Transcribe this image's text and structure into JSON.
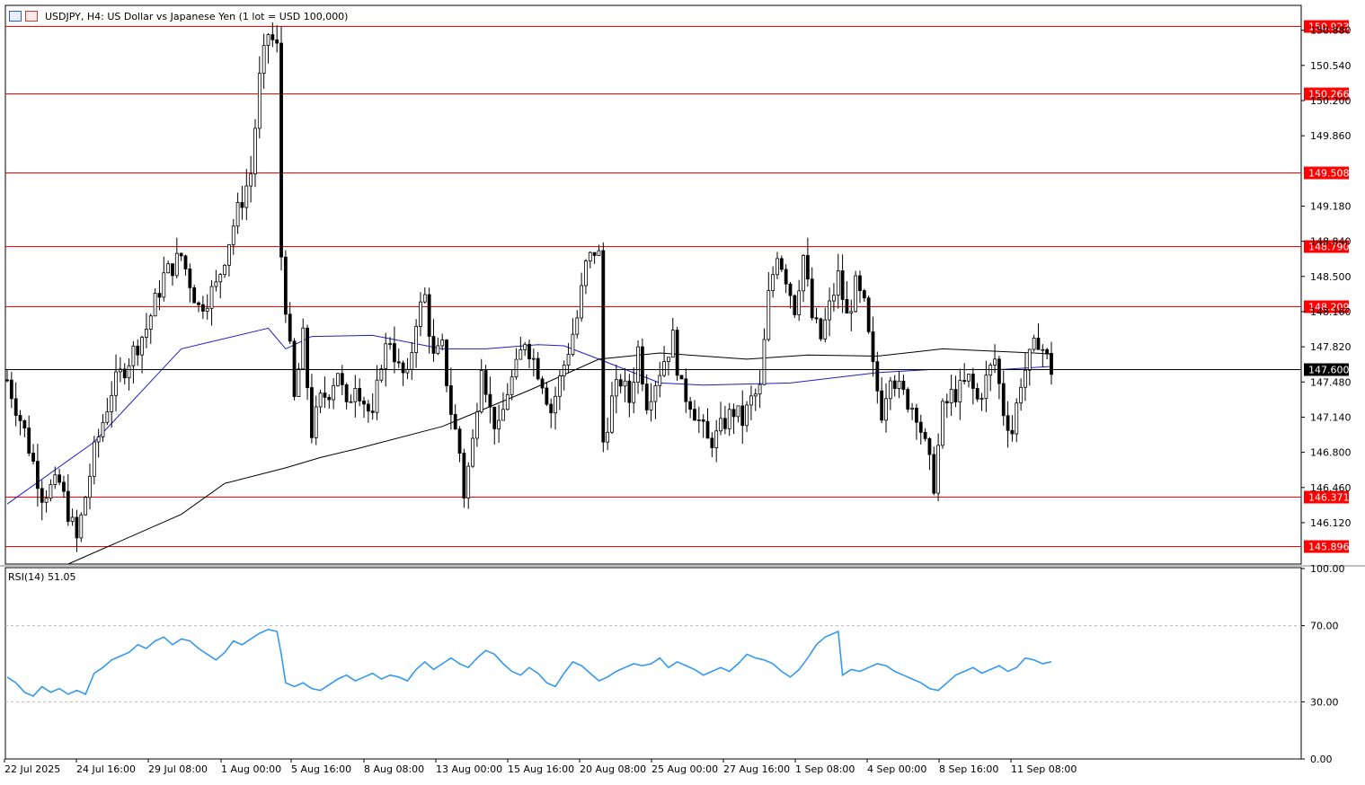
{
  "header": {
    "title": "USDJPY, H4:  US Dollar vs Japanese Yen (1 lot = USD 100,000)"
  },
  "colors": {
    "level_line": "#ff0000",
    "level_label_bg": "#ff0000",
    "price_label_bg": "#000000",
    "ma_fast": "#1f1fcc",
    "ma_slow": "#000000",
    "rsi_line": "#3399ee"
  },
  "chart_data": [
    {
      "type": "candlestick",
      "symbol": "USDJPY",
      "timeframe": "H4",
      "ylim": [
        145.72,
        151.12
      ],
      "y_ticks": [
        "150.880",
        "150.540",
        "150.200",
        "149.860",
        "149.180",
        "148.840",
        "148.500",
        "148.160",
        "147.820",
        "147.480",
        "147.140",
        "146.800",
        "146.460",
        "146.120"
      ],
      "x_tick_labels": [
        "22 Jul 2025",
        "24 Jul 16:00",
        "29 Jul 08:00",
        "1 Aug 00:00",
        "5 Aug 16:00",
        "8 Aug 08:00",
        "13 Aug 00:00",
        "15 Aug 16:00",
        "20 Aug 08:00",
        "25 Aug 00:00",
        "27 Aug 16:00",
        "1 Sep 08:00",
        "4 Sep 00:00",
        "8 Sep 16:00",
        "11 Sep 08:00"
      ],
      "horizontal_levels": [
        150.923,
        150.266,
        149.508,
        148.79,
        148.209,
        146.371,
        145.896
      ],
      "horizontal_level_labels": [
        "150.923",
        "150.266",
        "149.508",
        "148.790",
        "148.209",
        "146.371",
        "145.896"
      ],
      "current_price": 147.6,
      "current_price_label": "147.600",
      "close_path": [
        [
          0,
          147.5
        ],
        [
          4,
          147.0
        ],
        [
          8,
          146.4
        ],
        [
          12,
          146.5
        ],
        [
          16,
          145.95
        ],
        [
          20,
          146.8
        ],
        [
          24,
          147.4
        ],
        [
          28,
          147.7
        ],
        [
          32,
          148.0
        ],
        [
          36,
          148.5
        ],
        [
          40,
          148.7
        ],
        [
          44,
          148.2
        ],
        [
          48,
          148.4
        ],
        [
          52,
          149.0
        ],
        [
          56,
          149.5
        ],
        [
          58,
          150.4
        ],
        [
          60,
          150.85
        ],
        [
          62,
          150.7
        ],
        [
          63,
          148.7
        ],
        [
          66,
          147.3
        ],
        [
          68,
          147.9
        ],
        [
          70,
          147.0
        ],
        [
          72,
          147.3
        ],
        [
          74,
          147.4
        ],
        [
          76,
          147.6
        ],
        [
          78,
          147.2
        ],
        [
          80,
          147.5
        ],
        [
          82,
          147.3
        ],
        [
          84,
          147.1
        ],
        [
          86,
          147.7
        ],
        [
          88,
          147.9
        ],
        [
          90,
          147.6
        ],
        [
          92,
          147.5
        ],
        [
          94,
          148.1
        ],
        [
          96,
          148.3
        ],
        [
          98,
          147.7
        ],
        [
          100,
          147.8
        ],
        [
          102,
          147.2
        ],
        [
          104,
          146.8
        ],
        [
          105,
          146.4
        ],
        [
          107,
          146.9
        ],
        [
          109,
          147.7
        ],
        [
          111,
          147.2
        ],
        [
          113,
          147.0
        ],
        [
          115,
          147.4
        ],
        [
          117,
          147.6
        ],
        [
          119,
          147.9
        ],
        [
          121,
          147.7
        ],
        [
          123,
          147.5
        ],
        [
          125,
          147.2
        ],
        [
          127,
          147.5
        ],
        [
          129,
          147.8
        ],
        [
          131,
          148.1
        ],
        [
          133,
          148.6
        ],
        [
          135,
          148.75
        ],
        [
          136,
          148.7
        ],
        [
          137,
          146.9
        ],
        [
          139,
          147.3
        ],
        [
          141,
          147.5
        ],
        [
          143,
          147.3
        ],
        [
          145,
          147.8
        ],
        [
          147,
          147.3
        ],
        [
          149,
          147.5
        ],
        [
          151,
          147.7
        ],
        [
          153,
          147.9
        ],
        [
          155,
          147.4
        ],
        [
          157,
          147.3
        ],
        [
          159,
          147.1
        ],
        [
          161,
          146.9
        ],
        [
          163,
          146.95
        ],
        [
          165,
          147.1
        ],
        [
          167,
          147.2
        ],
        [
          169,
          147.1
        ],
        [
          171,
          147.3
        ],
        [
          173,
          147.4
        ],
        [
          175,
          148.3
        ],
        [
          177,
          148.75
        ],
        [
          179,
          148.5
        ],
        [
          181,
          148.2
        ],
        [
          183,
          148.7
        ],
        [
          185,
          148.1
        ],
        [
          187,
          147.9
        ],
        [
          189,
          148.2
        ],
        [
          191,
          148.5
        ],
        [
          193,
          148.1
        ],
        [
          195,
          148.4
        ],
        [
          197,
          148.2
        ],
        [
          199,
          147.6
        ],
        [
          201,
          147.2
        ],
        [
          203,
          147.6
        ],
        [
          205,
          147.4
        ],
        [
          207,
          147.3
        ],
        [
          209,
          147.2
        ],
        [
          211,
          146.85
        ],
        [
          213,
          146.5
        ],
        [
          215,
          147.2
        ],
        [
          217,
          147.35
        ],
        [
          219,
          147.4
        ],
        [
          221,
          147.5
        ],
        [
          223,
          147.3
        ],
        [
          225,
          147.5
        ],
        [
          227,
          147.7
        ],
        [
          229,
          147.2
        ],
        [
          231,
          147.0
        ],
        [
          233,
          147.5
        ],
        [
          235,
          147.7
        ],
        [
          237,
          147.9
        ],
        [
          239,
          147.7
        ],
        [
          240,
          147.6
        ]
      ],
      "series": [
        {
          "name": "",
          "color": "#1f1fcc",
          "values": [
            [
              0,
              146.3
            ],
            [
              20,
              146.9
            ],
            [
              40,
              147.8
            ],
            [
              60,
              148.0
            ],
            [
              64,
              147.8
            ],
            [
              70,
              147.92
            ],
            [
              84,
              147.93
            ],
            [
              100,
              147.8
            ],
            [
              110,
              147.8
            ],
            [
              122,
              147.84
            ],
            [
              128,
              147.83
            ],
            [
              136,
              147.7
            ],
            [
              150,
              147.47
            ],
            [
              160,
              147.45
            ],
            [
              180,
              147.47
            ],
            [
              200,
              147.57
            ],
            [
              212,
              147.6
            ],
            [
              228,
              147.6
            ],
            [
              240,
              147.63
            ]
          ]
        },
        {
          "name": "",
          "color": "#000000",
          "values": [
            [
              14,
              145.72
            ],
            [
              40,
              146.2
            ],
            [
              50,
              146.5
            ],
            [
              64,
              146.65
            ],
            [
              72,
              146.75
            ],
            [
              80,
              146.83
            ],
            [
              100,
              147.05
            ],
            [
              120,
              147.4
            ],
            [
              136,
              147.7
            ],
            [
              150,
              147.76
            ],
            [
              170,
              147.7
            ],
            [
              184,
              147.74
            ],
            [
              200,
              147.73
            ],
            [
              215,
              147.8
            ],
            [
              236,
              147.76
            ],
            [
              240,
              147.75
            ]
          ]
        }
      ]
    },
    {
      "type": "line",
      "title": "RSI(14) 51.05",
      "ylim": [
        0,
        100
      ],
      "y_ticks": [
        "100.00",
        "70.00",
        "30.00",
        "0.00"
      ],
      "levels": [
        70,
        30
      ],
      "series": [
        {
          "name": "RSI(14)",
          "color": "#3399ee",
          "values": [
            [
              0,
              43
            ],
            [
              2,
              40
            ],
            [
              4,
              35
            ],
            [
              6,
              33
            ],
            [
              8,
              38
            ],
            [
              10,
              35
            ],
            [
              12,
              37
            ],
            [
              14,
              34
            ],
            [
              16,
              36
            ],
            [
              18,
              34
            ],
            [
              20,
              45
            ],
            [
              22,
              48
            ],
            [
              24,
              52
            ],
            [
              26,
              54
            ],
            [
              28,
              56
            ],
            [
              30,
              60
            ],
            [
              32,
              58
            ],
            [
              34,
              62
            ],
            [
              36,
              64
            ],
            [
              38,
              60
            ],
            [
              40,
              63
            ],
            [
              42,
              62
            ],
            [
              44,
              58
            ],
            [
              46,
              55
            ],
            [
              48,
              52
            ],
            [
              50,
              56
            ],
            [
              52,
              62
            ],
            [
              54,
              60
            ],
            [
              56,
              63
            ],
            [
              58,
              66
            ],
            [
              60,
              68
            ],
            [
              62,
              67
            ],
            [
              63,
              55
            ],
            [
              64,
              40
            ],
            [
              66,
              38
            ],
            [
              68,
              40
            ],
            [
              70,
              37
            ],
            [
              72,
              36
            ],
            [
              74,
              39
            ],
            [
              76,
              42
            ],
            [
              78,
              44
            ],
            [
              80,
              41
            ],
            [
              82,
              43
            ],
            [
              84,
              45
            ],
            [
              86,
              42
            ],
            [
              88,
              44
            ],
            [
              90,
              43
            ],
            [
              92,
              41
            ],
            [
              94,
              47
            ],
            [
              96,
              51
            ],
            [
              98,
              47
            ],
            [
              100,
              50
            ],
            [
              102,
              53
            ],
            [
              104,
              50
            ],
            [
              106,
              48
            ],
            [
              108,
              53
            ],
            [
              110,
              57
            ],
            [
              112,
              55
            ],
            [
              114,
              50
            ],
            [
              116,
              46
            ],
            [
              118,
              44
            ],
            [
              120,
              48
            ],
            [
              122,
              45
            ],
            [
              124,
              40
            ],
            [
              126,
              38
            ],
            [
              128,
              45
            ],
            [
              130,
              51
            ],
            [
              132,
              49
            ],
            [
              134,
              45
            ],
            [
              136,
              41
            ],
            [
              138,
              43
            ],
            [
              140,
              46
            ],
            [
              142,
              48
            ],
            [
              144,
              50
            ],
            [
              146,
              49
            ],
            [
              148,
              50
            ],
            [
              150,
              53
            ],
            [
              152,
              48
            ],
            [
              154,
              51
            ],
            [
              156,
              49
            ],
            [
              158,
              47
            ],
            [
              160,
              44
            ],
            [
              162,
              46
            ],
            [
              164,
              48
            ],
            [
              166,
              46
            ],
            [
              168,
              50
            ],
            [
              170,
              55
            ],
            [
              172,
              53
            ],
            [
              174,
              52
            ],
            [
              176,
              50
            ],
            [
              178,
              46
            ],
            [
              180,
              43
            ],
            [
              182,
              47
            ],
            [
              184,
              53
            ],
            [
              186,
              60
            ],
            [
              188,
              64
            ],
            [
              190,
              66
            ],
            [
              191,
              67
            ],
            [
              192,
              44
            ],
            [
              194,
              47
            ],
            [
              196,
              46
            ],
            [
              198,
              48
            ],
            [
              200,
              50
            ],
            [
              202,
              49
            ],
            [
              204,
              46
            ],
            [
              206,
              44
            ],
            [
              208,
              42
            ],
            [
              210,
              40
            ],
            [
              212,
              37
            ],
            [
              214,
              36
            ],
            [
              216,
              40
            ],
            [
              218,
              44
            ],
            [
              220,
              46
            ],
            [
              222,
              48
            ],
            [
              224,
              45
            ],
            [
              226,
              47
            ],
            [
              228,
              49
            ],
            [
              230,
              46
            ],
            [
              232,
              48
            ],
            [
              234,
              53
            ],
            [
              236,
              52
            ],
            [
              238,
              50
            ],
            [
              240,
              51.05
            ]
          ]
        }
      ]
    }
  ]
}
